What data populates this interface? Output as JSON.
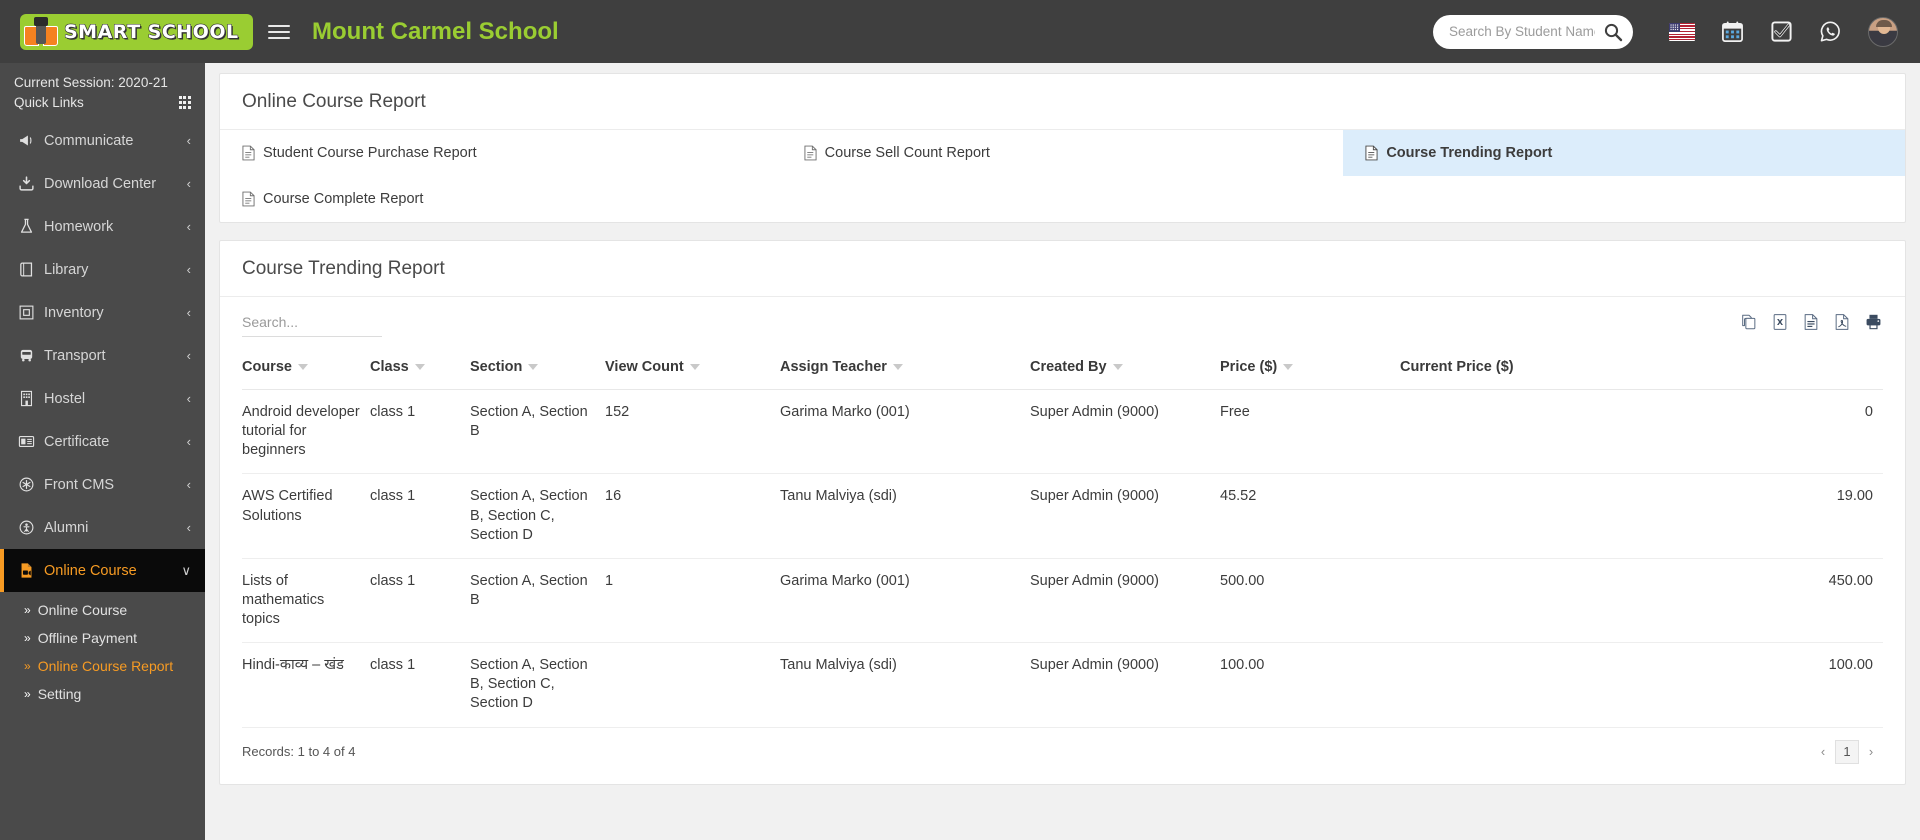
{
  "header": {
    "logo_text": "SMART SCHOOL",
    "brand_title": "Mount Carmel School",
    "search_placeholder": "Search By Student Name, Roll Number ...",
    "search_value": "",
    "icons": [
      "menu-icon",
      "search-icon",
      "flag-usa-icon",
      "calendar-icon",
      "check-square-icon",
      "whatsapp-icon",
      "avatar"
    ]
  },
  "sidebar": {
    "session_label": "Current Session: 2020-21",
    "quick_links_label": "Quick Links",
    "items": [
      {
        "label": "Communicate",
        "icon": "megaphone-icon",
        "caret": "‹",
        "active": false
      },
      {
        "label": "Download Center",
        "icon": "download-icon",
        "caret": "‹",
        "active": false
      },
      {
        "label": "Homework",
        "icon": "flask-icon",
        "caret": "‹",
        "active": false
      },
      {
        "label": "Library",
        "icon": "book-icon",
        "caret": "‹",
        "active": false
      },
      {
        "label": "Inventory",
        "icon": "inventory-icon",
        "caret": "‹",
        "active": false
      },
      {
        "label": "Transport",
        "icon": "bus-icon",
        "caret": "‹",
        "active": false
      },
      {
        "label": "Hostel",
        "icon": "building-icon",
        "caret": "‹",
        "active": false
      },
      {
        "label": "Certificate",
        "icon": "id-card-icon",
        "caret": "‹",
        "active": false
      },
      {
        "label": "Front CMS",
        "icon": "asterisk-icon",
        "caret": "‹",
        "active": false
      },
      {
        "label": "Alumni",
        "icon": "person-icon",
        "caret": "‹",
        "active": false
      },
      {
        "label": "Online Course",
        "icon": "video-file-icon",
        "caret": "∨",
        "active": true
      }
    ],
    "submenu": [
      {
        "label": "Online Course",
        "active": false
      },
      {
        "label": "Offline Payment",
        "active": false
      },
      {
        "label": "Online Course Report",
        "active": true
      },
      {
        "label": "Setting",
        "active": false
      }
    ]
  },
  "main": {
    "page_title": "Online Course Report",
    "report_tabs": [
      {
        "label": "Student Course Purchase Report",
        "active": false
      },
      {
        "label": "Course Sell Count Report",
        "active": false
      },
      {
        "label": "Course Trending Report",
        "active": true
      },
      {
        "label": "Course Complete Report",
        "active": false
      }
    ],
    "table_title": "Course Trending Report",
    "search_placeholder": "Search...",
    "search_value": "",
    "export_buttons": [
      {
        "name": "copy-icon",
        "label": "Copy"
      },
      {
        "name": "excel-icon",
        "label": "Excel"
      },
      {
        "name": "csv-icon",
        "label": "CSV"
      },
      {
        "name": "pdf-icon",
        "label": "PDF"
      },
      {
        "name": "print-icon",
        "label": "Print"
      }
    ],
    "table": {
      "columns": [
        "Course",
        "Class",
        "Section",
        "View Count",
        "Assign Teacher",
        "Created By",
        "Price ($)",
        "Current Price ($)"
      ],
      "rows": [
        {
          "course": "Android developer tutorial for beginners",
          "class": "class 1",
          "section": "Section A, Section B",
          "view_count": "152",
          "assign_teacher": "Garima Marko (001)",
          "created_by": "Super Admin (9000)",
          "price": "Free",
          "current_price": "0"
        },
        {
          "course": "AWS Certified Solutions",
          "class": "class 1",
          "section": "Section A, Section B, Section C, Section D",
          "view_count": "16",
          "assign_teacher": "Tanu Malviya (sdi)",
          "created_by": "Super Admin (9000)",
          "price": "45.52",
          "current_price": "19.00"
        },
        {
          "course": "Lists of mathematics topics",
          "class": "class 1",
          "section": "Section A, Section B",
          "view_count": "1",
          "assign_teacher": "Garima Marko (001)",
          "created_by": "Super Admin (9000)",
          "price": "500.00",
          "current_price": "450.00"
        },
        {
          "course": "Hindi-काव्य – खंड",
          "class": "class 1",
          "section": "Section A, Section B, Section C, Section D",
          "view_count": "",
          "assign_teacher": "Tanu Malviya (sdi)",
          "created_by": "Super Admin (9000)",
          "price": "100.00",
          "current_price": "100.00"
        }
      ],
      "records_label": "Records: 1 to 4 of 4",
      "pagination": {
        "prev": "‹",
        "current_page": "1",
        "next": "›"
      }
    }
  },
  "colors": {
    "header_bg": "#3f3f3f",
    "sidebar_bg": "#4a4a4a",
    "accent_orange": "#f79b23",
    "brand_green": "#9acd32",
    "active_tab_bg": "#dcedfb"
  }
}
